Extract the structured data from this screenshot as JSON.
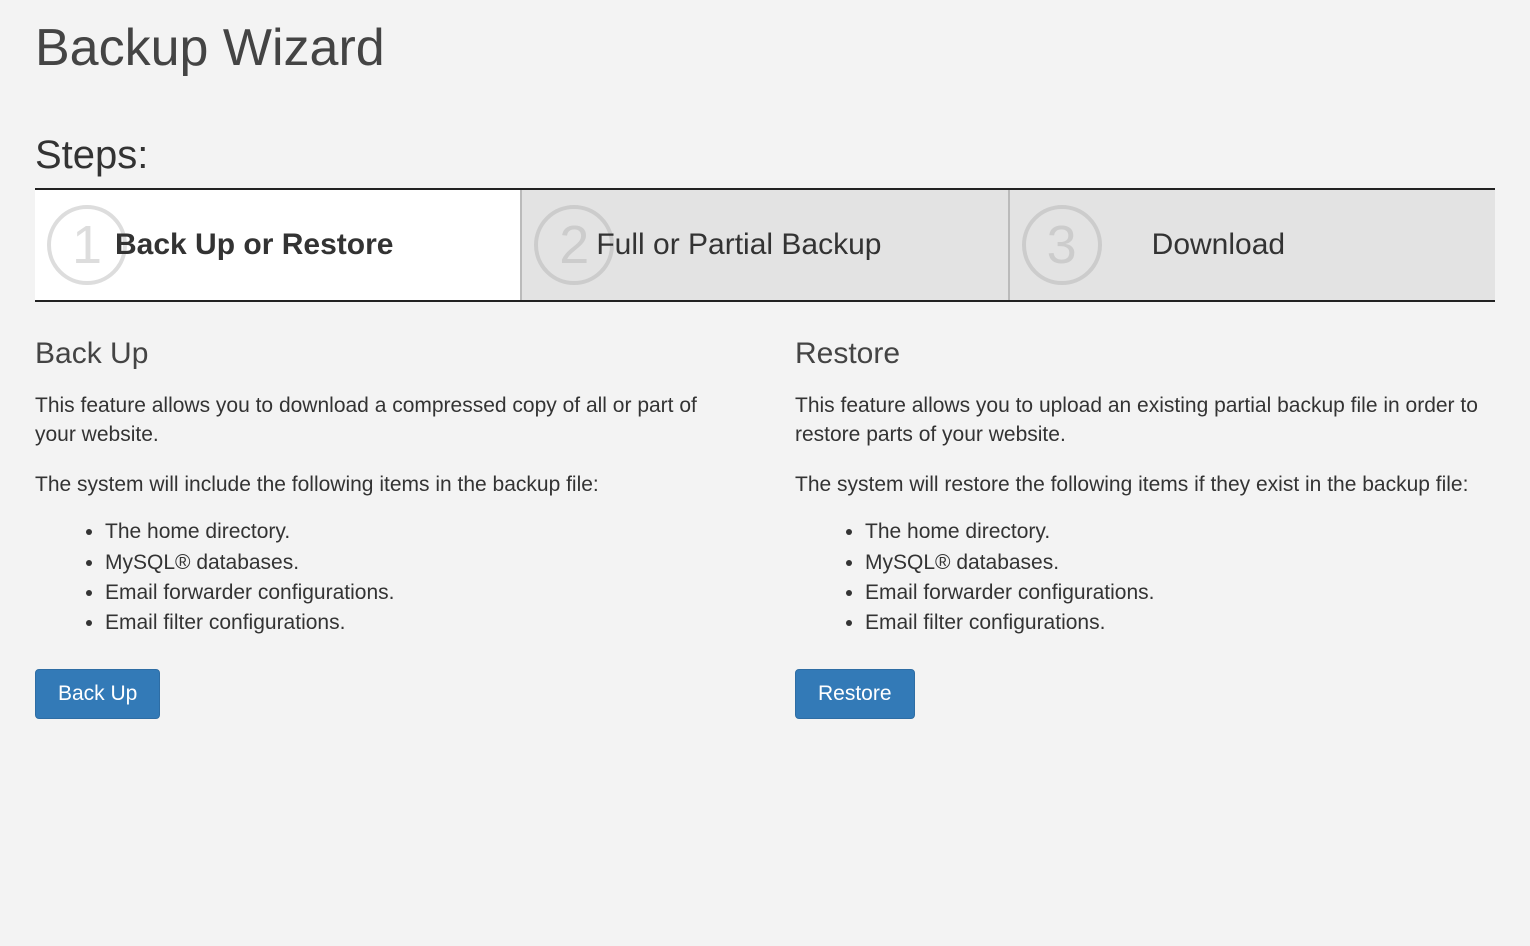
{
  "pageTitle": "Backup Wizard",
  "stepsHeading": "Steps:",
  "steps": [
    {
      "num": "1",
      "label": "Back Up or Restore"
    },
    {
      "num": "2",
      "label": "Full or Partial Backup"
    },
    {
      "num": "3",
      "label": "Download"
    }
  ],
  "backup": {
    "title": "Back Up",
    "desc": "This feature allows you to download a compressed copy of all or part of your website.",
    "listIntro": "The system will include the following items in the backup file:",
    "items": [
      "The home directory.",
      "MySQL® databases.",
      "Email forwarder configurations.",
      "Email filter configurations."
    ],
    "button": "Back Up"
  },
  "restore": {
    "title": "Restore",
    "desc": "This feature allows you to upload an existing partial backup file in order to restore parts of your website.",
    "listIntro": "The system will restore the following items if they exist in the backup file:",
    "items": [
      "The home directory.",
      "MySQL® databases.",
      "Email forwarder configurations.",
      "Email filter configurations."
    ],
    "button": "Restore"
  }
}
